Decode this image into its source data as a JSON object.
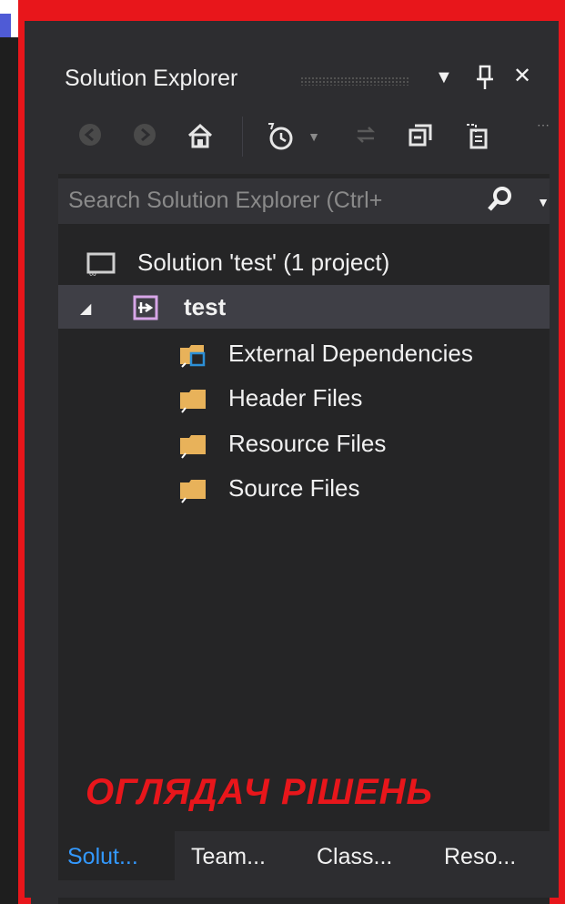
{
  "panel": {
    "title": "Solution Explorer",
    "controls": {
      "dropdown": "▼",
      "pin": "🖈",
      "close": "✕"
    }
  },
  "toolbar": {
    "icons": [
      "back-icon",
      "forward-icon",
      "home-icon",
      "pending-changes-icon",
      "sync-icon",
      "collapse-all-icon",
      "show-all-files-icon"
    ]
  },
  "search": {
    "placeholder": "Search Solution Explorer (Ctrl+"
  },
  "tree": {
    "solution": "Solution 'test' (1 project)",
    "project": "test",
    "folders": [
      "External Dependencies",
      "Header Files",
      "Resource Files",
      "Source Files"
    ]
  },
  "overlay_label": "ОГЛЯДАЧ РІШЕНЬ",
  "tabs": [
    "Solut...",
    "Team...",
    "Class...",
    "Reso..."
  ],
  "colors": {
    "accent_red": "#e8161b",
    "tab_active": "#3399ff",
    "folder": "#e8b25a"
  }
}
